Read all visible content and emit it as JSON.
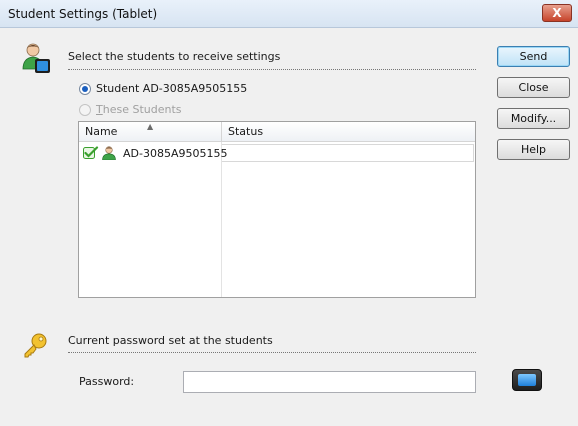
{
  "window": {
    "title": "Student Settings (Tablet)",
    "close_glyph": "X"
  },
  "students_section": {
    "heading": "Select the students to receive settings",
    "radio_student": "Student AD-3085A9505155",
    "radio_these_prefix": "T",
    "radio_these_rest": "hese Students"
  },
  "list": {
    "columns": {
      "name": "Name",
      "status": "Status"
    },
    "rows": [
      {
        "name": "AD-3085A9505155",
        "status": ""
      }
    ]
  },
  "buttons": {
    "send": "Send",
    "close": "Close",
    "modify": "Modify...",
    "help": "Help"
  },
  "password_section": {
    "heading": "Current password set at the students",
    "label": "Password:",
    "value": ""
  },
  "icons": {
    "header_icon": "student-tablet-icon",
    "checkmark": "check-icon",
    "student": "student-icon",
    "key": "key-icon",
    "tablet": "tablet-icon"
  },
  "colors": {
    "accent": "#1b5fbf",
    "close_button": "#c6442b",
    "check_green": "#3aa02e"
  }
}
